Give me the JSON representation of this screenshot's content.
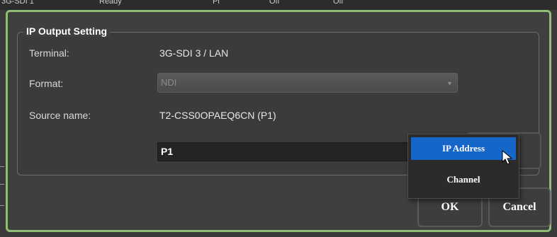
{
  "background": {
    "strip_texts": [
      "3G-SDI 1",
      "Ready",
      "Pi",
      "Off",
      "Off"
    ]
  },
  "dialog": {
    "border_color": "#8fbf74",
    "group_title": "IP Output Setting",
    "terminal_label": "Terminal:",
    "terminal_value": "3G-SDI 3 / LAN",
    "format_label": "Format:",
    "format_value": "NDI",
    "source_name_label": "Source name:",
    "source_name_value": "T2-CSS0OPAEQ6CN (P1)",
    "name_field_value": "P1",
    "ok_label": "OK",
    "cancel_label": "Cancel"
  },
  "context_menu": {
    "items": [
      {
        "label": "IP Address",
        "selected": true
      },
      {
        "label": "Channel",
        "selected": false
      }
    ],
    "selected_color": "#1665c9"
  }
}
